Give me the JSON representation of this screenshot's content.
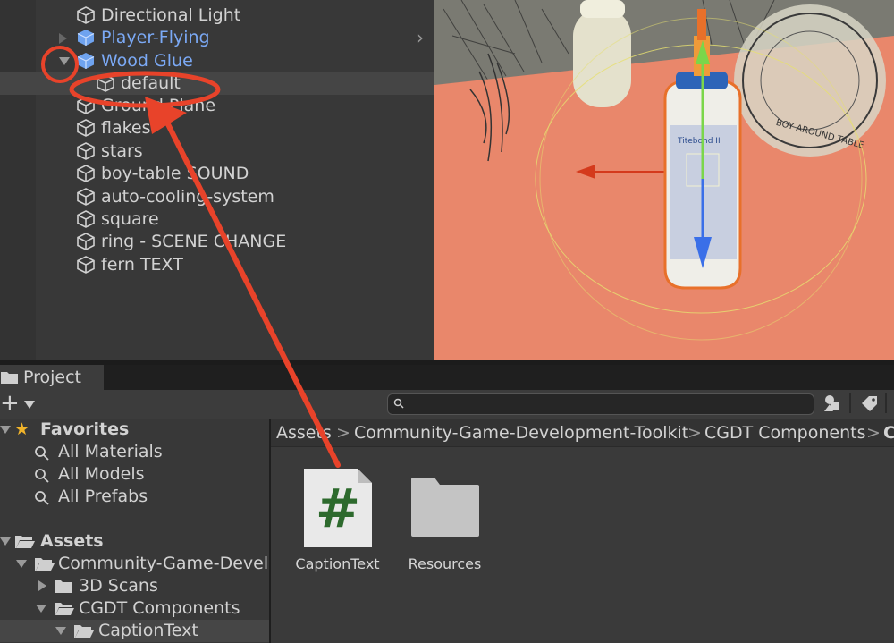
{
  "hierarchy": {
    "items": [
      {
        "label": "Directional Light"
      },
      {
        "label": "Player-Flying"
      },
      {
        "label": "Wood Glue"
      },
      {
        "label": "default"
      },
      {
        "label": "Ground Plane"
      },
      {
        "label": "flakes"
      },
      {
        "label": "stars"
      },
      {
        "label": "boy-table SOUND"
      },
      {
        "label": "auto-cooling-system"
      },
      {
        "label": "square"
      },
      {
        "label": "ring - SCENE CHANGE"
      },
      {
        "label": "fern TEXT"
      }
    ]
  },
  "project": {
    "tab_label": "Project",
    "add_label": "+",
    "search_placeholder": "",
    "favorites": {
      "label": "Favorites",
      "items": [
        "All Materials",
        "All Models",
        "All Prefabs"
      ]
    },
    "assets_tree": {
      "label": "Assets",
      "items": [
        "Community-Game-Develo",
        "3D Scans",
        "CGDT Components",
        "CaptionText"
      ]
    },
    "breadcrumb": [
      "Assets",
      "Community-Game-Development-Toolkit",
      "CGDT Components",
      "C"
    ],
    "breadcrumb_sep": ">",
    "files": [
      {
        "name": "CaptionText",
        "icon": "csharp-script-icon",
        "glyph": "#"
      },
      {
        "name": "Resources",
        "icon": "folder-icon"
      }
    ]
  },
  "scene": {
    "bottle_label": "Titebond II",
    "stamp_text": "BOY AROUND TABLE"
  },
  "colors": {
    "prefab_blue": "#7ba9f5",
    "annotation_red": "#e8432a",
    "scene_floor": "#e9876b",
    "script_green": "#2d6a2d"
  }
}
